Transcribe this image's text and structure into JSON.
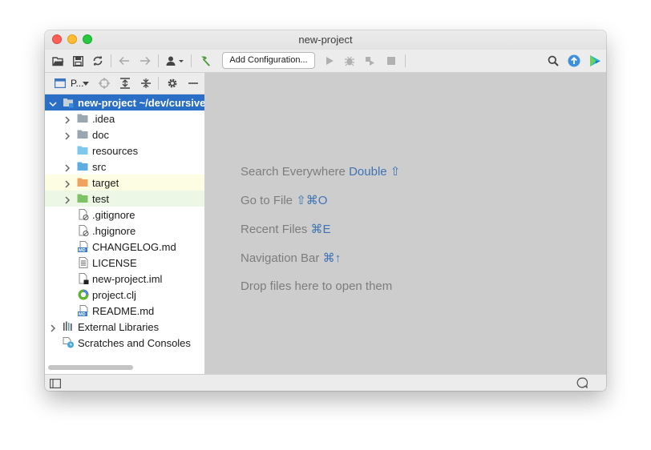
{
  "window": {
    "title": "new-project"
  },
  "toolbar": {
    "add_config_label": "Add Configuration..."
  },
  "sidebar": {
    "view_label": "P...",
    "tree": [
      {
        "label": "new-project",
        "suffix": " ~/dev/cursive",
        "icon": "module-folder-icon",
        "expanded": true,
        "state": "selected"
      },
      {
        "label": ".idea",
        "icon": "folder-icon",
        "arrow": true
      },
      {
        "label": "doc",
        "icon": "folder-icon",
        "arrow": true
      },
      {
        "label": "resources",
        "icon": "resources-folder-icon",
        "arrow": false
      },
      {
        "label": "src",
        "icon": "source-folder-icon",
        "arrow": true
      },
      {
        "label": "target",
        "icon": "excluded-folder-icon",
        "arrow": true,
        "state": "excluded"
      },
      {
        "label": "test",
        "icon": "test-folder-icon",
        "arrow": true,
        "state": "test"
      },
      {
        "label": ".gitignore",
        "icon": "ignore-file-icon"
      },
      {
        "label": ".hgignore",
        "icon": "ignore-file-icon"
      },
      {
        "label": "CHANGELOG.md",
        "icon": "markdown-file-icon"
      },
      {
        "label": "LICENSE",
        "icon": "text-file-icon"
      },
      {
        "label": "new-project.iml",
        "icon": "iml-file-icon"
      },
      {
        "label": "project.clj",
        "icon": "clojure-file-icon"
      },
      {
        "label": "README.md",
        "icon": "markdown-file-icon"
      },
      {
        "label": "External Libraries",
        "icon": "libraries-icon",
        "arrow": true
      },
      {
        "label": "Scratches and Consoles",
        "icon": "scratches-icon"
      }
    ]
  },
  "editor": {
    "hints": [
      {
        "text": "Search Everywhere",
        "key": "Double ⇧"
      },
      {
        "text": "Go to File",
        "key": "⇧⌘O"
      },
      {
        "text": "Recent Files",
        "key": "⌘E"
      },
      {
        "text": "Navigation Bar",
        "key": "⌘↑"
      },
      {
        "text": "Drop files here to open them",
        "key": ""
      }
    ]
  },
  "colors": {
    "selection": "#2a6ec5",
    "folder": "#9aa7b0",
    "source_folder": "#5dade2",
    "excluded_folder": "#f0a35e",
    "test_folder": "#7ec363",
    "hint_key": "#3e73b4"
  }
}
